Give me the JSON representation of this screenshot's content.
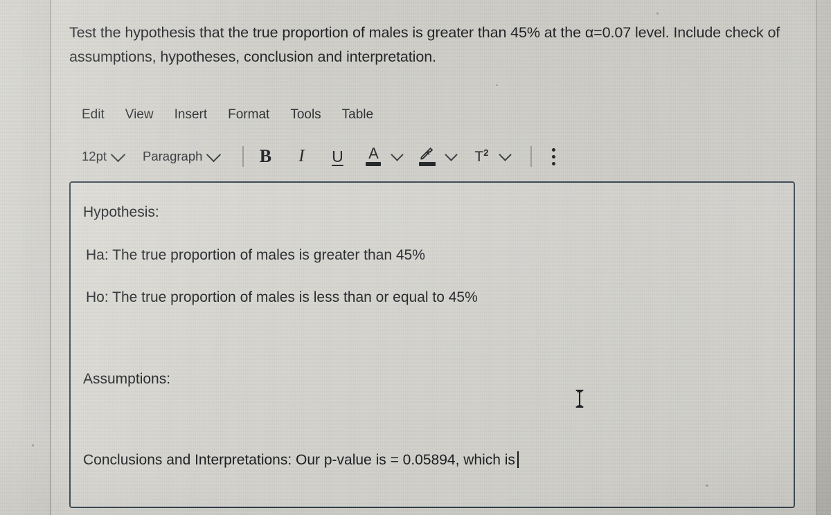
{
  "prompt": {
    "text": "Test the hypothesis that the true proportion of males is greater than 45% at the α=0.07 level. Include check of assumptions, hypotheses, conclusion and interpretation."
  },
  "menubar": {
    "items": [
      {
        "label": "Edit"
      },
      {
        "label": "View"
      },
      {
        "label": "Insert"
      },
      {
        "label": "Format"
      },
      {
        "label": "Tools"
      },
      {
        "label": "Table"
      }
    ]
  },
  "toolbar": {
    "font_size": {
      "value": "12pt",
      "icon": "chevron-down-icon"
    },
    "block_format": {
      "value": "Paragraph",
      "icon": "chevron-down-icon"
    },
    "bold": {
      "label": "B",
      "icon": "bold-icon"
    },
    "italic": {
      "label": "I",
      "icon": "italic-icon"
    },
    "underline": {
      "label": "U",
      "icon": "underline-icon"
    },
    "text_color": {
      "label": "A",
      "icon": "text-color-icon",
      "swatch": "#111417"
    },
    "highlight": {
      "label": "",
      "icon": "highlighter-icon",
      "swatch": "#111417"
    },
    "superscript": {
      "label": "T",
      "sup": "2",
      "icon": "superscript-icon"
    },
    "more_options": {
      "icon": "kebab-menu-icon"
    }
  },
  "editor": {
    "lines": [
      {
        "id": "hypothesis-heading",
        "text": "Hypothesis:"
      },
      {
        "id": "alternative-hypothesis",
        "text": "Ha: The true proportion of males is greater than 45%"
      },
      {
        "id": "null-hypothesis",
        "text": "Ho: The true proportion of males is less than or equal to 45%"
      },
      {
        "id": "assumptions-heading",
        "text": "Assumptions:"
      },
      {
        "id": "conclusions-line",
        "text": "Conclusions and Interpretations: Our p-value is = 0.05894, which is"
      }
    ],
    "p_value": "0.05894",
    "significance_level": "0.07",
    "proportion_threshold": "45%"
  },
  "colors": {
    "editor_border": "#2c3b46",
    "page_background": "#cdccc6",
    "text": "#16191c"
  }
}
